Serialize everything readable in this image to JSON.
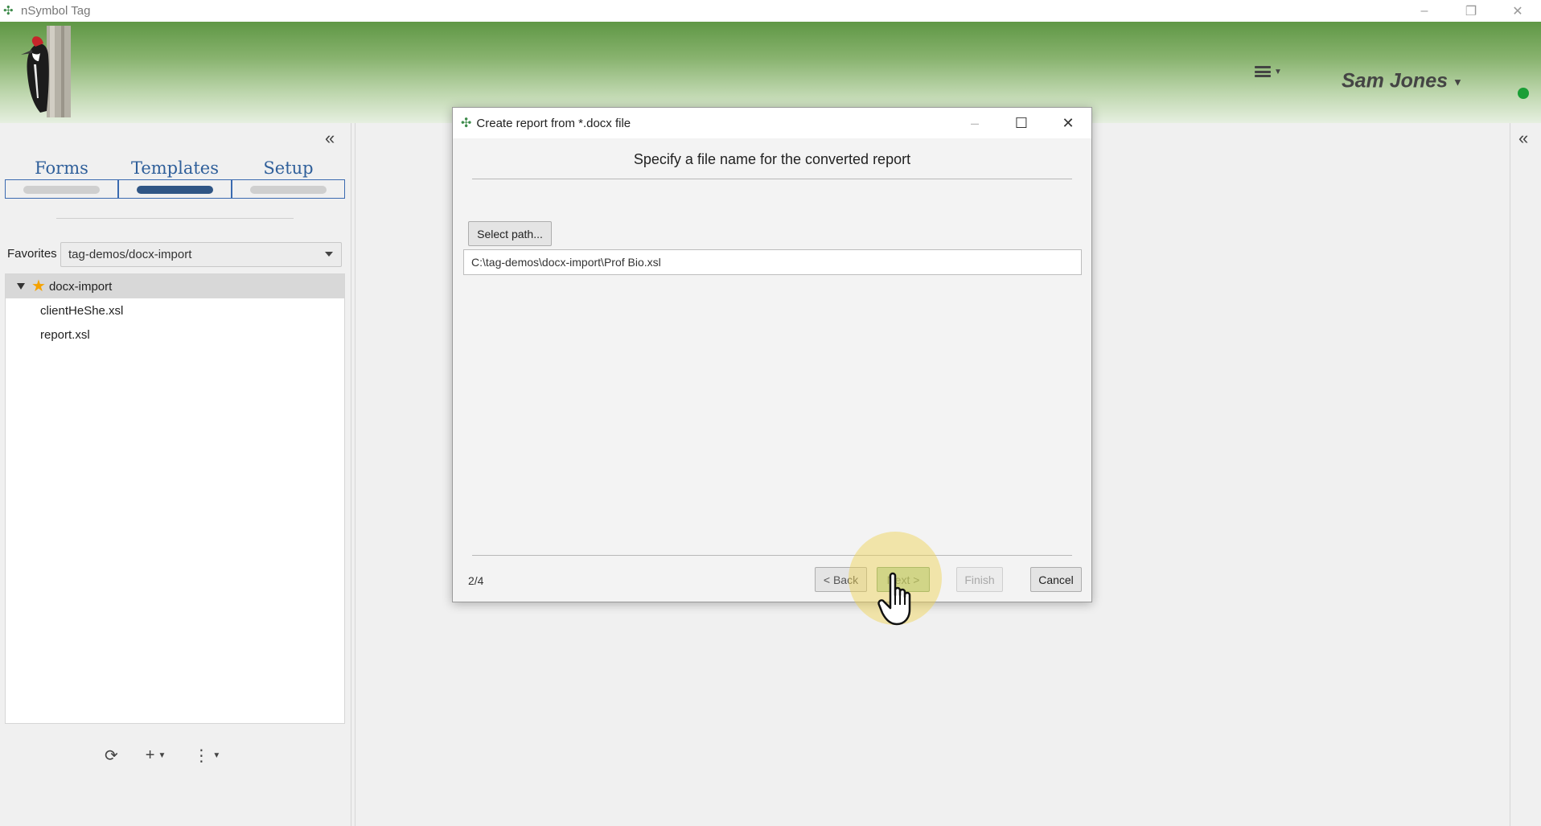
{
  "window": {
    "title": "nSymbol Tag",
    "controls": {
      "minimize": "–",
      "restore": "❐",
      "close": "✕"
    }
  },
  "header": {
    "user_name": "Sam Jones",
    "status_color": "#1a9e36",
    "menu_icon": "hamburger-menu-icon"
  },
  "left_panel": {
    "tabs": [
      {
        "label": "Forms",
        "active": false
      },
      {
        "label": "Templates",
        "active": true
      },
      {
        "label": "Setup",
        "active": false
      }
    ],
    "favorites": {
      "label": "Favorites",
      "selected": "tag-demos/docx-import"
    },
    "tree": {
      "folder": "docx-import",
      "files": [
        "clientHeShe.xsl",
        "report.xsl"
      ]
    },
    "tools": [
      "refresh-icon",
      "add-icon",
      "more-options-icon"
    ]
  },
  "dialog": {
    "title": "Create report from *.docx file",
    "heading": "Specify a file name for the converted report",
    "select_path_label": "Select path...",
    "path_value": "C:\\tag-demos\\docx-import\\Prof Bio.xsl",
    "step": "2/4",
    "buttons": {
      "back": "< Back",
      "next": "Next >",
      "finish": "Finish",
      "cancel": "Cancel"
    }
  },
  "colors": {
    "accent_blue": "#2f5f9a",
    "next_button_green": "#b9d7b4",
    "banner_green": "#5f9745",
    "star": "#f5a200"
  }
}
